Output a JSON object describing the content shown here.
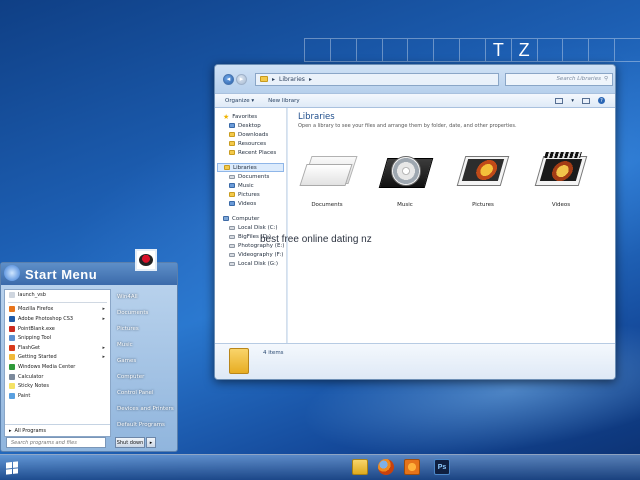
{
  "tiles": {
    "letters": [
      "T",
      "Z"
    ]
  },
  "explorer": {
    "address_label": "Libraries",
    "address_chevron": "▸",
    "search_placeholder": "Search Libraries",
    "toolbar": {
      "organize": "Organize ▾",
      "new_library": "New library"
    },
    "favorites": {
      "label": "Favorites",
      "items": [
        "Desktop",
        "Downloads",
        "Resources",
        "Recent Places"
      ]
    },
    "libraries": {
      "label": "Libraries",
      "items": [
        "Documents",
        "Music",
        "Pictures",
        "Videos"
      ]
    },
    "computer": {
      "label": "Computer",
      "items": [
        "Local Disk (C:)",
        "BigFiles (D:)",
        "Photography (E:)",
        "Videography (F:)",
        "Local Disk (G:)"
      ]
    },
    "content_title": "Libraries",
    "content_subtitle": "Open a library to see your files and arrange them by folder, date, and other properties.",
    "library_tiles": [
      "Documents",
      "Music",
      "Pictures",
      "Videos"
    ],
    "details_count": "4 items"
  },
  "overlay_text": "best free online dating nz",
  "start_menu": {
    "title": "Start Menu",
    "programs": [
      {
        "label": "launch_vsb",
        "color": "#cfd6df",
        "arrow": ""
      },
      {
        "label": "Mozilla Firefox",
        "color": "#e8741b",
        "arrow": "▸"
      },
      {
        "label": "Adobe Photoshop CS3",
        "color": "#1e5aa8",
        "arrow": "▸"
      },
      {
        "label": "PointBlank.exe",
        "color": "#cc2a1e",
        "arrow": ""
      },
      {
        "label": "Snipping Tool",
        "color": "#5b8fd0",
        "arrow": ""
      },
      {
        "label": "FlashGet",
        "color": "#d93a1c",
        "arrow": "▸"
      },
      {
        "label": "Getting Started",
        "color": "#f0b93a",
        "arrow": "▸"
      },
      {
        "label": "Windows Media Center",
        "color": "#2f9a3a",
        "arrow": ""
      },
      {
        "label": "Calculator",
        "color": "#7b8a9c",
        "arrow": ""
      },
      {
        "label": "Sticky Notes",
        "color": "#f5e265",
        "arrow": ""
      },
      {
        "label": "Paint",
        "color": "#5aa0e0",
        "arrow": ""
      }
    ],
    "all_programs": "All Programs",
    "right_items": [
      "Win4All",
      "Documents",
      "Pictures",
      "Music",
      "Games",
      "Computer",
      "Control Panel",
      "Devices and Printers",
      "Default Programs"
    ],
    "search_placeholder": "Search programs and files",
    "shutdown": "Shut down",
    "shutdown_arrow": "▸"
  },
  "taskbar": {
    "apps": [
      "windows-explorer",
      "firefox",
      "media-player",
      "photoshop"
    ],
    "ps_label": "Ps"
  }
}
